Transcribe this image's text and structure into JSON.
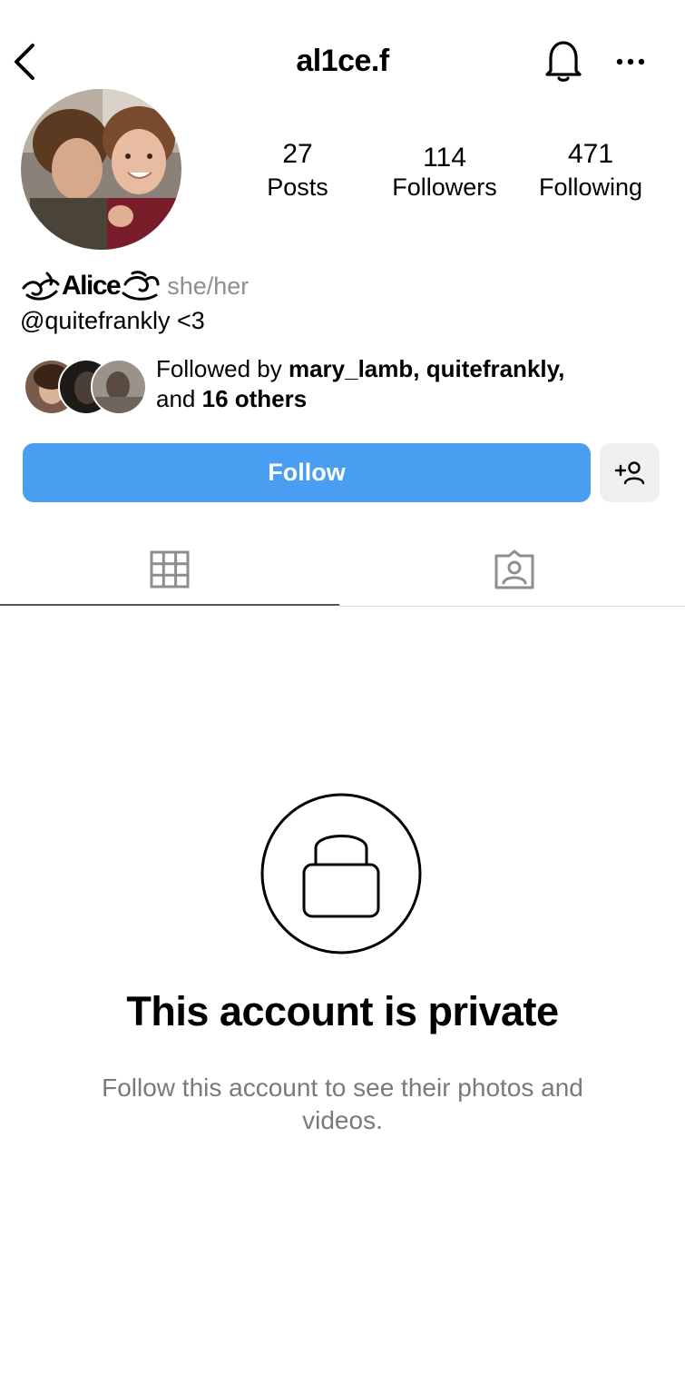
{
  "header": {
    "username": "al1ce.f"
  },
  "stats": [
    {
      "count": "27",
      "label": "Posts"
    },
    {
      "count": "114",
      "label": "Followers"
    },
    {
      "count": "471",
      "label": "Following"
    }
  ],
  "bio": {
    "display_name": "Alice",
    "pronouns": "she/her",
    "line": "@quitefrankly <3"
  },
  "followed_by": {
    "prefix": "Followed by ",
    "names": "mary_lamb, quitefrankly,",
    "and_text": "and ",
    "others": "16 others"
  },
  "actions": {
    "follow_label": "Follow"
  },
  "private": {
    "title": "This account is private",
    "subtitle": "Follow this account to see their photos and videos."
  },
  "colors": {
    "follow_button": "#4a9ef2",
    "secondary_button": "#efefef",
    "muted_text": "#8e8e8e"
  },
  "icons": [
    "back-icon",
    "bell-icon",
    "more-icon",
    "add-person-icon",
    "grid-icon",
    "tagged-icon",
    "lock-icon"
  ]
}
